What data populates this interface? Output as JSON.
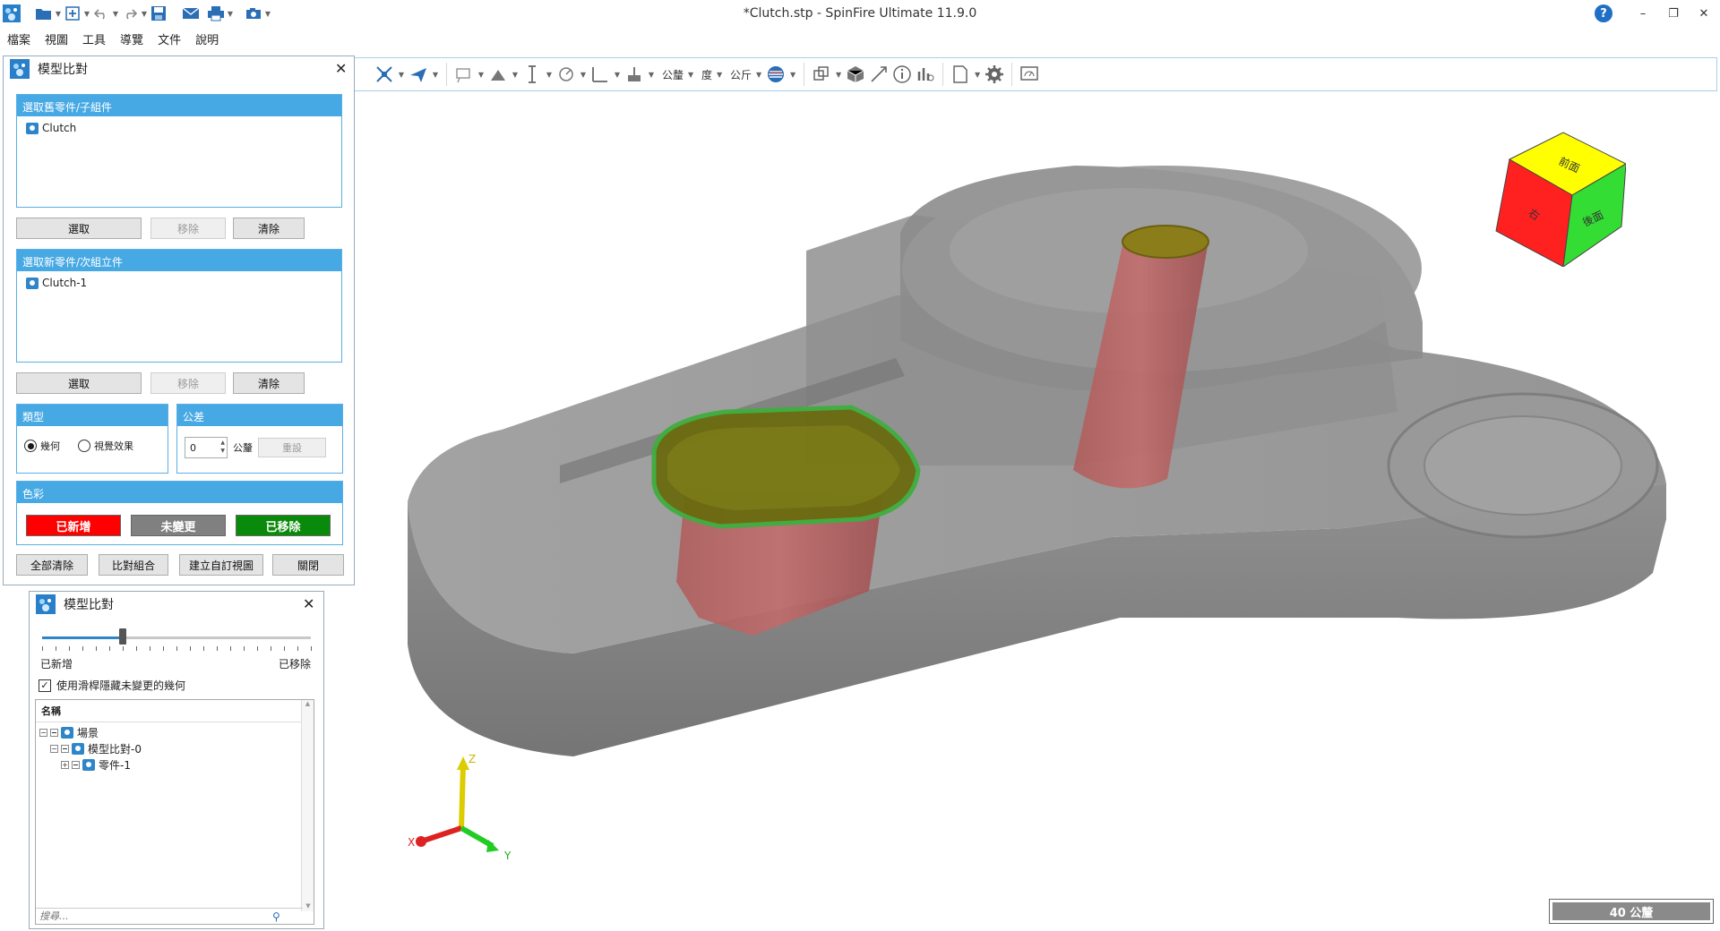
{
  "window": {
    "title": "*Clutch.stp - SpinFire Ultimate 11.9.0",
    "minimize": "–",
    "restore": "❐",
    "close": "✕",
    "help": "?"
  },
  "menu": [
    "檔案",
    "視圖",
    "工具",
    "導覽",
    "文件",
    "說明"
  ],
  "toolbar": {
    "tolerance_label": "公釐",
    "degree_label": "度",
    "weight_label": "公斤"
  },
  "compare_panel": {
    "title": "模型比對",
    "old_group": {
      "header": "選取舊零件/子組件",
      "item": "Clutch",
      "select": "選取",
      "remove": "移除",
      "clear": "清除"
    },
    "new_group": {
      "header": "選取新零件/次組立件",
      "item": "Clutch-1",
      "select": "選取",
      "remove": "移除",
      "clear": "清除"
    },
    "type": {
      "header": "類型",
      "geometry": "幾何",
      "visual": "視覺效果",
      "selected": "geometry"
    },
    "tolerance": {
      "header": "公差",
      "value": "0",
      "unit": "公釐",
      "reset": "重設"
    },
    "colors": {
      "header": "色彩",
      "added": "已新增",
      "unchanged": "未變更",
      "removed": "已移除",
      "added_color": "#ff0000",
      "unchanged_color": "#808080",
      "removed_color": "#0a8a0a"
    },
    "buttons": {
      "clear_all": "全部清除",
      "compare": "比對組合",
      "create_view": "建立自訂視圖",
      "close": "關閉"
    }
  },
  "slider_panel": {
    "title": "模型比對",
    "slider_value": 0.3,
    "left_label": "已新增",
    "right_label": "已移除",
    "checkbox_label": "使用滑桿隱藏未變更的幾何",
    "checkbox_checked": true,
    "tree_header": "名稱",
    "tree": {
      "root": "場景",
      "child": "模型比對-0",
      "grandchild": "零件-1"
    },
    "search_placeholder": "搜尋..."
  },
  "viewcube": {
    "top": "前面",
    "left": "右",
    "right": "後面"
  },
  "axes": {
    "x": "X",
    "y": "Y",
    "z": "Z"
  },
  "scale": "40 公釐"
}
